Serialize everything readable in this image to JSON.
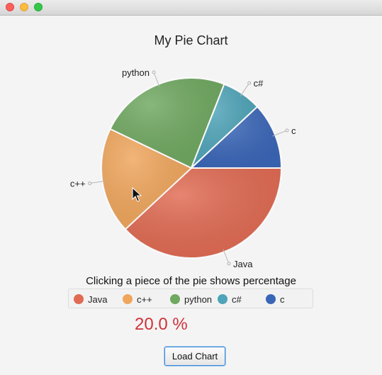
{
  "window": {
    "title": ""
  },
  "chart_data": {
    "type": "pie",
    "title": "My Pie Chart",
    "slices": [
      {
        "label": "Java",
        "value": 40,
        "color": "#e06a52"
      },
      {
        "label": "c++",
        "value": 20,
        "color": "#f0a65c"
      },
      {
        "label": "python",
        "value": 25,
        "color": "#6fa860"
      },
      {
        "label": "c#",
        "value": 7.5,
        "color": "#4ea4b8"
      },
      {
        "label": "c",
        "value": 12.5,
        "color": "#3a66b8"
      }
    ],
    "legend_position": "bottom"
  },
  "caption": "Clicking a piece of the pie shows percentage",
  "legend": {
    "items": [
      {
        "label": "Java",
        "color": "#e06a52"
      },
      {
        "label": "c++",
        "color": "#f0a65c"
      },
      {
        "label": "python",
        "color": "#6fa860"
      },
      {
        "label": "c#",
        "color": "#4ea4b8"
      },
      {
        "label": "c",
        "color": "#3a66b8"
      }
    ]
  },
  "result": {
    "percent_text": "20.0 %"
  },
  "buttons": {
    "load_label": "Load Chart"
  }
}
